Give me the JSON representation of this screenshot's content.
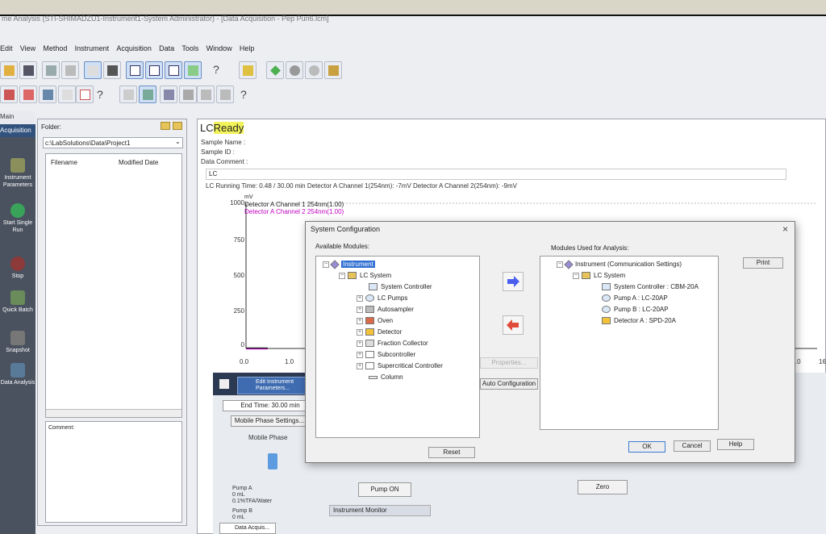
{
  "window": {
    "title": "me Analysis (STI-SHIMADZU1-Instrument1-System Administrator) - [Data Acquisition - Pep Puri6.lcm]"
  },
  "menu": [
    "Edit",
    "View",
    "Method",
    "Instrument",
    "Acquisition",
    "Data",
    "Tools",
    "Window",
    "Help"
  ],
  "leftnav": {
    "header": "Main",
    "active": "Acquisition",
    "items": [
      {
        "label": "Instrument Parameters",
        "icon": "instrument-parameters-icon"
      },
      {
        "label": "Start Single Run",
        "icon": "start-run-icon"
      },
      {
        "label": "Stop",
        "icon": "stop-icon"
      },
      {
        "label": "Quick Batch",
        "icon": "quick-batch-icon"
      },
      {
        "label": "Snapshot",
        "icon": "snapshot-icon"
      },
      {
        "label": "Data Analysis",
        "icon": "data-analysis-icon"
      }
    ]
  },
  "folder": {
    "label": "Folder:",
    "path": "c:\\LabSolutions\\Data\\Project1",
    "columns": [
      "Filename",
      "Modified Date"
    ],
    "comment_label": "Comment:"
  },
  "main": {
    "lc_prefix": "LC",
    "status": "Ready",
    "sample_name": "Sample Name :",
    "sample_id": "Sample ID :",
    "data_comment": "Data Comment :",
    "lc_tab": "LC",
    "running_line": "LC Running Time: 0.48 / 30.00 min Detector A Channel 1(254nm): -7mV Detector A Channel 2(254nm): -9mV"
  },
  "chart_data": {
    "type": "line",
    "ylabel": "mV",
    "yticks": [
      "1000",
      "750",
      "500",
      "250",
      "0"
    ],
    "xticks": [
      "0.0",
      "1.0",
      "15.0",
      "16"
    ],
    "ylim": [
      0,
      1000
    ],
    "series": [
      {
        "name": "Detector A Channel 1 254nm(1.00)",
        "color": "#222222",
        "x": [
          0.0,
          0.2,
          0.48
        ],
        "y": [
          -7,
          -7,
          -7
        ]
      },
      {
        "name": "Detector A Channel 2 254nm(1.00)",
        "color": "#c000c0",
        "x": [
          0.0,
          0.2,
          0.48
        ],
        "y": [
          -9,
          -9,
          -9
        ]
      }
    ]
  },
  "lower": {
    "edit_btn": "Edit Instrument Parameters...",
    "end_time": "End Time:  30.00 min",
    "mobile_phase_btn": "Mobile Phase Settings...",
    "mobile_phase_label": "Mobile Phase",
    "pump_a": [
      "Pump A",
      "0      mL",
      "0.1%TFA/Water"
    ],
    "pump_b": [
      "Pump B",
      "0      mL"
    ],
    "pump_on": "Pump ON",
    "zero": "Zero",
    "monitor": "Instrument Monitor",
    "bottom_tab": "Data Acquis..."
  },
  "dialog": {
    "title": "System Configuration",
    "available_label": "Available Modules:",
    "used_label": "Modules Used for Analysis:",
    "available_tree": {
      "root": "Instrument",
      "lc_system": "LC System",
      "children": [
        "System Controller",
        "LC Pumps",
        "Autosampler",
        "Oven",
        "Detector",
        "Fraction Collector",
        "Subcontroller",
        "Supercritical Controller",
        "Column"
      ]
    },
    "used_tree": {
      "root": "Instrument (Communication Settings)",
      "lc_system": "LC System",
      "children": [
        "System Controller : CBM-20A",
        "Pump A : LC-20AP",
        "Pump B : LC-20AP",
        "Detector A : SPD-20A"
      ]
    },
    "buttons": {
      "properties": "Properties...",
      "auto_config": "Auto Configuration",
      "reset": "Reset",
      "print": "Print",
      "ok": "OK",
      "cancel": "Cancel",
      "help": "Help"
    }
  }
}
